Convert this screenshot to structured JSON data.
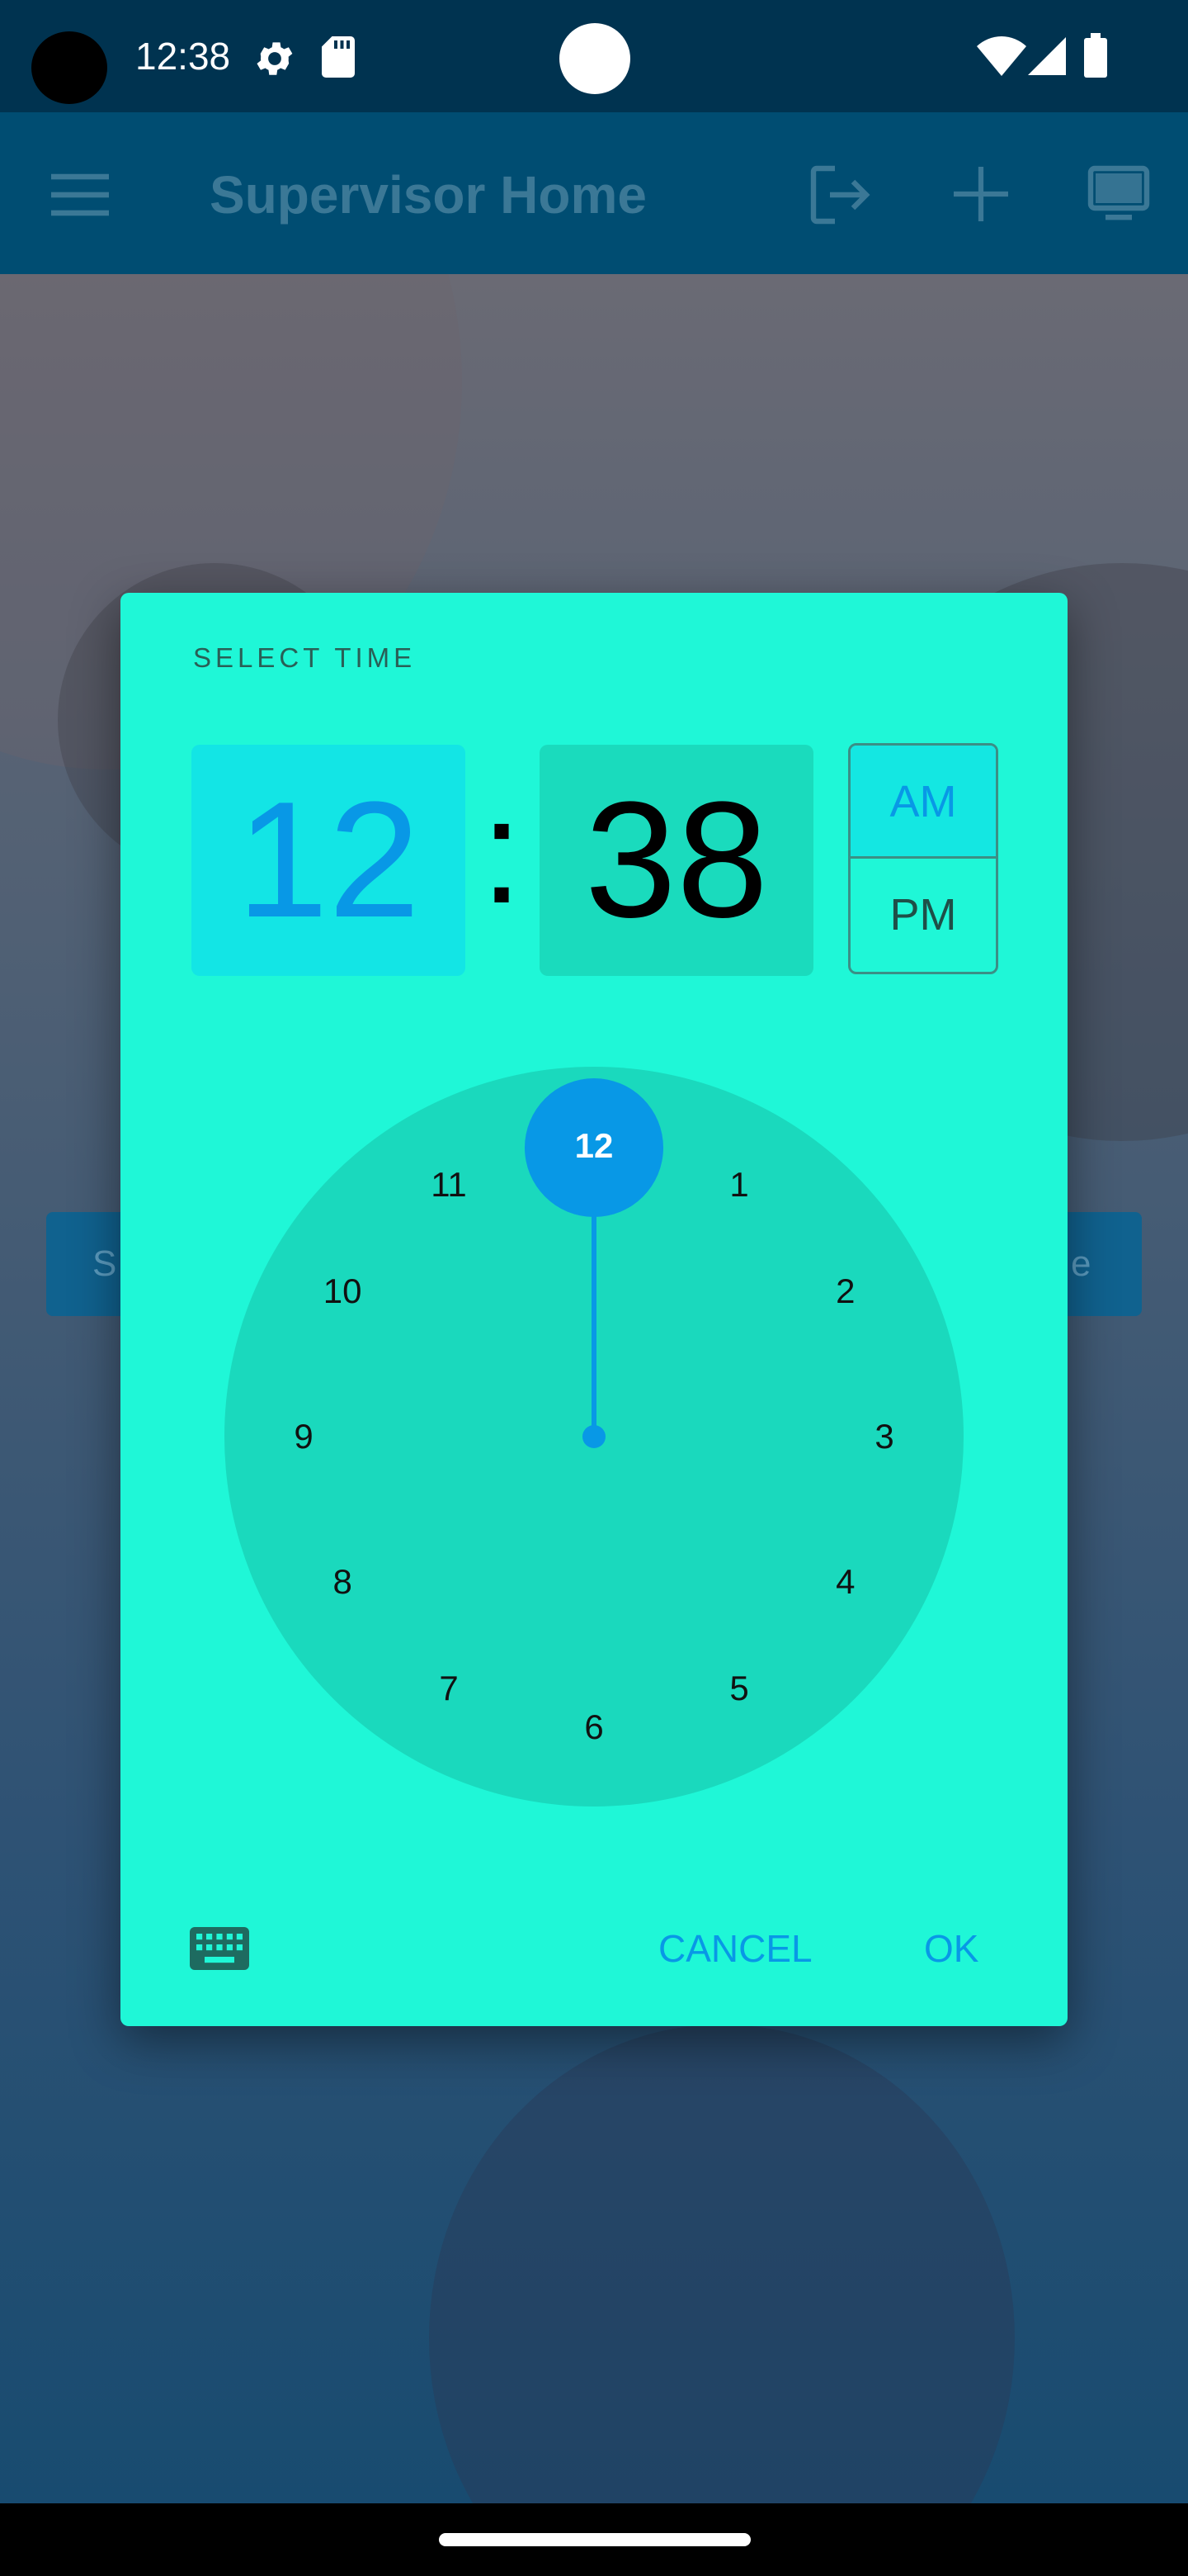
{
  "status_bar": {
    "time": "12:38",
    "icons": [
      "gear-icon",
      "sd-card-icon",
      "wifi-icon",
      "signal-icon",
      "battery-icon"
    ]
  },
  "app_bar": {
    "title": "Supervisor Home",
    "icons": [
      "menu-icon",
      "logout-icon",
      "add-icon",
      "monitor-icon"
    ]
  },
  "background": {
    "button_left_text": "S",
    "button_right_text": "e"
  },
  "dialog": {
    "title": "SELECT TIME",
    "hour": "12",
    "separator": ":",
    "minute": "38",
    "am_label": "AM",
    "pm_label": "PM",
    "selected_period": "AM",
    "clock_numbers": [
      "12",
      "1",
      "2",
      "3",
      "4",
      "5",
      "6",
      "7",
      "8",
      "9",
      "10",
      "11"
    ],
    "selected_number": "12",
    "cancel_label": "CANCEL",
    "ok_label": "OK",
    "input_mode_icon": "keyboard-icon"
  },
  "colors": {
    "status_bar": "#003350",
    "app_bar": "#004d72",
    "dialog_bg": "#1ff7d7",
    "accent": "#0898e6",
    "clock_face": "#1ad9bd"
  }
}
